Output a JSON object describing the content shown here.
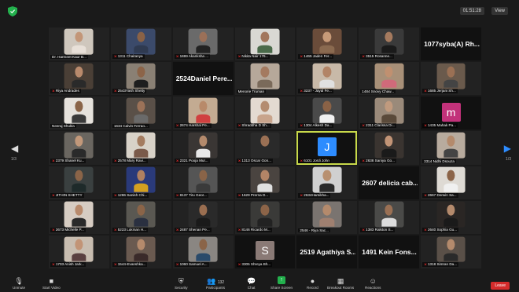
{
  "topbar": {
    "timer": "01:51:28",
    "view_label": "View"
  },
  "nav": {
    "left_arrow": "◀",
    "right_arrow": "▶",
    "page_left": "1/3",
    "page_right": "1/3"
  },
  "grid": {
    "tiles": [
      {
        "type": "cam",
        "name": "Dr. Harmeet Kaur B...",
        "muted": false,
        "bg": "#cfc7bd",
        "skin": "#c39678",
        "shirt": "#e8e0d8"
      },
      {
        "type": "cam",
        "name": "1311 Chaitanya",
        "muted": true,
        "bg": "#3b4a6a",
        "skin": "#8a6246",
        "shirt": "#2f3a50"
      },
      {
        "type": "cam",
        "name": "1699 Akanksha ...",
        "muted": true,
        "bg": "#6a6a6a",
        "skin": "#9b7058",
        "shirt": "#222"
      },
      {
        "type": "cam",
        "name": "Nikita Nair 176...",
        "muted": true,
        "bg": "#d9d8d3",
        "skin": "#a2765c",
        "shirt": "#4a6a4a"
      },
      {
        "type": "cam",
        "name": "1465 Jaden Fer...",
        "muted": true,
        "bg": "#6a4c3a",
        "skin": "#c79a78",
        "shirt": "#8a6a50"
      },
      {
        "type": "cam",
        "name": "3515 Rosanne...",
        "muted": true,
        "bg": "#3a3a3a",
        "skin": "#a57a5e",
        "shirt": "#1a1a1a"
      },
      {
        "type": "text",
        "name": "1077syba(A) Rh..."
      },
      {
        "type": "cam",
        "name": "Riya Andrades",
        "muted": true,
        "bg": "#4a3f36",
        "skin": "#b98a6c",
        "shirt": "#2a2a2a"
      },
      {
        "type": "cam",
        "name": "2543Yash Shetty",
        "muted": true,
        "bg": "#8a8074",
        "skin": "#8c6448",
        "shirt": "#1e1e1e"
      },
      {
        "type": "text",
        "name": "2524Daniel Pere..."
      },
      {
        "type": "cam",
        "name": "Menorie Truman",
        "muted": false,
        "bg": "#b6a89a",
        "skin": "#a47a60",
        "shirt": "#7a6a5a"
      },
      {
        "type": "cam",
        "name": "3237 - Jayal Fe...",
        "muted": true,
        "bg": "#c8b9a8",
        "skin": "#b28466",
        "shirt": "#e0e0e0"
      },
      {
        "type": "cam",
        "name": "1484 Snovy Chaw...",
        "muted": false,
        "bg": "#a89078",
        "skin": "#c09070",
        "shirt": "#d06a7a"
      },
      {
        "type": "cam",
        "name": "1685 Jerjani Sh...",
        "muted": true,
        "bg": "#6a5a4c",
        "skin": "#9a7054",
        "shirt": "#444"
      },
      {
        "type": "cam",
        "name": "Neeraj Shukla",
        "muted": false,
        "bg": "#e6e2dc",
        "skin": "#8a6448",
        "shirt": "#3a3a3a"
      },
      {
        "type": "cam",
        "name": "1634 Calvin Ferrao...",
        "muted": false,
        "bg": "#5a5048",
        "skin": "#9c7258",
        "shirt": "#6a6a6a"
      },
      {
        "type": "cam",
        "name": "2674 Harshal Pe...",
        "muted": true,
        "bg": "#c3ab92",
        "skin": "#b88a6a",
        "shirt": "#d04040"
      },
      {
        "type": "cam",
        "name": "Shraddha D Sh...",
        "muted": true,
        "bg": "#e3dad1",
        "skin": "#b48c70",
        "shirt": "#c8a48c"
      },
      {
        "type": "cam",
        "name": "1304 Alkesh Da...",
        "muted": true,
        "bg": "#4a4a4a",
        "skin": "#8a6246",
        "shirt": "#f0f0f0"
      },
      {
        "type": "cam",
        "name": "2311 Clarissa Di...",
        "muted": true,
        "bg": "#9a8a7a",
        "skin": "#c09a7e",
        "shirt": "#5a4a3a"
      },
      {
        "type": "avatar",
        "name": "1435 Mahak Pa...",
        "muted": true,
        "letter": "m",
        "color": "#c2327a"
      },
      {
        "type": "cam",
        "name": "2379 Shanel Ku...",
        "muted": true,
        "bg": "#6a6660",
        "skin": "#c2987a",
        "shirt": "#2a2a2a"
      },
      {
        "type": "cam",
        "name": "2578 Mary Ravi...",
        "muted": true,
        "bg": "#d8d2c8",
        "skin": "#a47c60",
        "shirt": "#7a5a4a"
      },
      {
        "type": "cam",
        "name": "2321 Pooja Mur...",
        "muted": true,
        "bg": "#3a3634",
        "skin": "#b48a6c",
        "shirt": "#e8e8e8"
      },
      {
        "type": "cam",
        "name": "1313 Oscar Gon...",
        "muted": true,
        "bg": "#2a2a2a",
        "skin": "#9a7054",
        "shirt": "#2a2a2a"
      },
      {
        "type": "avatar",
        "name": "6101 Jordi John",
        "muted": true,
        "letter": "J",
        "color": "#2d8cff",
        "active": true
      },
      {
        "type": "cam",
        "name": "2638 Saniya Go...",
        "muted": true,
        "bg": "#3a3430",
        "skin": "#c29476",
        "shirt": "#1a1a1a"
      },
      {
        "type": "cam",
        "name": "3314 Nidhi Dsouza",
        "muted": false,
        "bg": "#b8ab9e",
        "skin": "#b48a6c",
        "shirt": "#444"
      },
      {
        "type": "cam",
        "name": "JITHIN SHETTY",
        "muted": true,
        "bg": "#3a4040",
        "skin": "#8a6448",
        "shirt": "#1e2a2a"
      },
      {
        "type": "cam",
        "name": "1286 Sanish Chi...",
        "muted": true,
        "bg": "#2a3a7a",
        "skin": "#b08060",
        "shirt": "#d4a020"
      },
      {
        "type": "cam",
        "name": "8137 Tiru Geor...",
        "muted": true,
        "bg": "#555",
        "skin": "#8a6448",
        "shirt": "#3a3a3a"
      },
      {
        "type": "cam",
        "name": "1629 Prerna D...",
        "muted": true,
        "bg": "#4a4440",
        "skin": "#b28466",
        "shirt": "#e0e0e0"
      },
      {
        "type": "cam",
        "name": "2634Harsikha...",
        "muted": true,
        "bg": "#d0d0d0",
        "skin": "#b89070",
        "shirt": "#2a2a2a"
      },
      {
        "type": "text",
        "name": "2607 delicia cab..."
      },
      {
        "type": "cam",
        "name": "2667 Derwin Sa...",
        "muted": true,
        "bg": "#dedad4",
        "skin": "#8c6448",
        "shirt": "#f0f0f0"
      },
      {
        "type": "cam",
        "name": "2673 Michelle P...",
        "muted": true,
        "bg": "#d6ccc2",
        "skin": "#b88a6c",
        "shirt": "#2a2a2a"
      },
      {
        "type": "cam",
        "name": "5223 Lukman H...",
        "muted": true,
        "bg": "#5a5852",
        "skin": "#8a6448",
        "shirt": "#2a3040"
      },
      {
        "type": "cam",
        "name": "2487 Shenan Pe...",
        "muted": true,
        "bg": "#2a2a2a",
        "skin": "#9a6e50",
        "shirt": "#1a1a1a"
      },
      {
        "type": "cam",
        "name": "8146 Ricardo M...",
        "muted": true,
        "bg": "#3a3a38",
        "skin": "#8c6448",
        "shirt": "#222"
      },
      {
        "type": "cam",
        "name": "2546 - Riya Sac...",
        "muted": false,
        "bg": "#7a7470",
        "skin": "#b48a6c",
        "shirt": "#a08070"
      },
      {
        "type": "cam",
        "name": "1383 Ralston S...",
        "muted": true,
        "bg": "#4a4a48",
        "skin": "#9a7054",
        "shirt": "#ddd"
      },
      {
        "type": "cam",
        "name": "2640 Sophia Gu...",
        "muted": true,
        "bg": "#2a2624",
        "skin": "#b48a6c",
        "shirt": "#1a1a1a"
      },
      {
        "type": "cam",
        "name": "1703 Anish Jark...",
        "muted": true,
        "bg": "#c8bdb0",
        "skin": "#c29476",
        "shirt": "#5a4040"
      },
      {
        "type": "cam",
        "name": "1544-Evanshka...",
        "muted": true,
        "bg": "#6a5a50",
        "skin": "#b48a6c",
        "shirt": "#3a2a2a"
      },
      {
        "type": "cam",
        "name": "1060 Samuel A...",
        "muted": true,
        "bg": "#8a8682",
        "skin": "#8a6448",
        "shirt": "#2a4a6a"
      },
      {
        "type": "avatar",
        "name": "3305 Shreya Bh...",
        "muted": true,
        "letter": "S",
        "color": "#8a7a76"
      },
      {
        "type": "text",
        "name": "2519 Agathiya S..."
      },
      {
        "type": "text",
        "name": "1491 Kein Fons..."
      },
      {
        "type": "cam",
        "name": "1318 Simran Da...",
        "muted": true,
        "bg": "#5a5048",
        "skin": "#b48a6c",
        "shirt": "#2a2a2a"
      }
    ]
  },
  "toolbar": {
    "unmute": "Unmute",
    "start_video": "Start Video",
    "security": "Security",
    "participants": "Participants",
    "participants_count": "132",
    "chat": "Chat",
    "share_screen": "Share Screen",
    "record": "Record",
    "breakout": "Breakout Rooms",
    "reactions": "Reactions",
    "leave": "Leave"
  },
  "colors": {
    "accent": "#2d8cff",
    "share_green": "#23b14d",
    "leave_red": "#d42b2b",
    "active_outline": "#c8d94a"
  }
}
